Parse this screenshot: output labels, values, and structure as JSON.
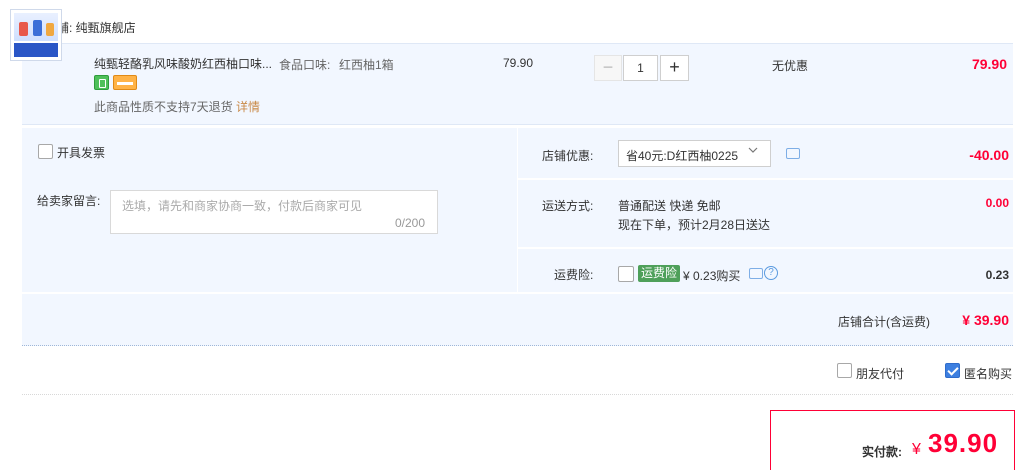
{
  "shop": {
    "badge": "天猫",
    "name": "店铺: 纯甄旗舰店"
  },
  "product": {
    "title": "纯甄轻酪乳风味酸奶红西柚口味...",
    "flavor_label": "食品口味:",
    "flavor_value": "红西柚1箱",
    "no_return_text": "此商品性质不支持7天退货",
    "detail_link": "详情",
    "unit_price": "79.90",
    "quantity": "1",
    "discount_text": "无优惠",
    "row_total": "79.90"
  },
  "options": {
    "invoice_label": "开具发票",
    "message_label": "给卖家留言:",
    "message_placeholder": "选填，请先和商家协商一致，付款后商家可见",
    "message_count": "0/200",
    "shop_coupon_label": "店铺优惠:",
    "shop_coupon_value": "省40元:D红西柚0225",
    "shop_coupon_amount": "-40.00",
    "shipping_label": "运送方式:",
    "shipping_line1": "普通配送 快递 免邮",
    "shipping_line2": "现在下单，预计2月28日送达",
    "shipping_amount": "0.00",
    "freight_insurance_label": "运费险:",
    "freight_insurance_badge": "运费险",
    "freight_insurance_price": "¥ 0.23购买",
    "freight_insurance_amount": "0.23",
    "help_glyph": "?"
  },
  "subtotal": {
    "label": "店铺合计(含运费)",
    "amount": "¥ 39.90"
  },
  "checkout_options": {
    "friend_pay_label": "朋友代付",
    "anonymous_label": "匿名购买",
    "anonymous_checked": true
  },
  "payment": {
    "label": "实付款:",
    "currency": "¥",
    "amount": "39.90"
  },
  "colors": {
    "accent": "#ff0036",
    "panel_bg": "#f2f7ff",
    "checkbox_checked": "#3d7fe0"
  },
  "icons": [
    "tmall-badge-icon",
    "product-thumbnail",
    "service-green-icon",
    "service-orange-icon",
    "minus-icon",
    "plus-icon",
    "chevron-down-icon",
    "chat-icon",
    "help-icon",
    "check-icon"
  ]
}
